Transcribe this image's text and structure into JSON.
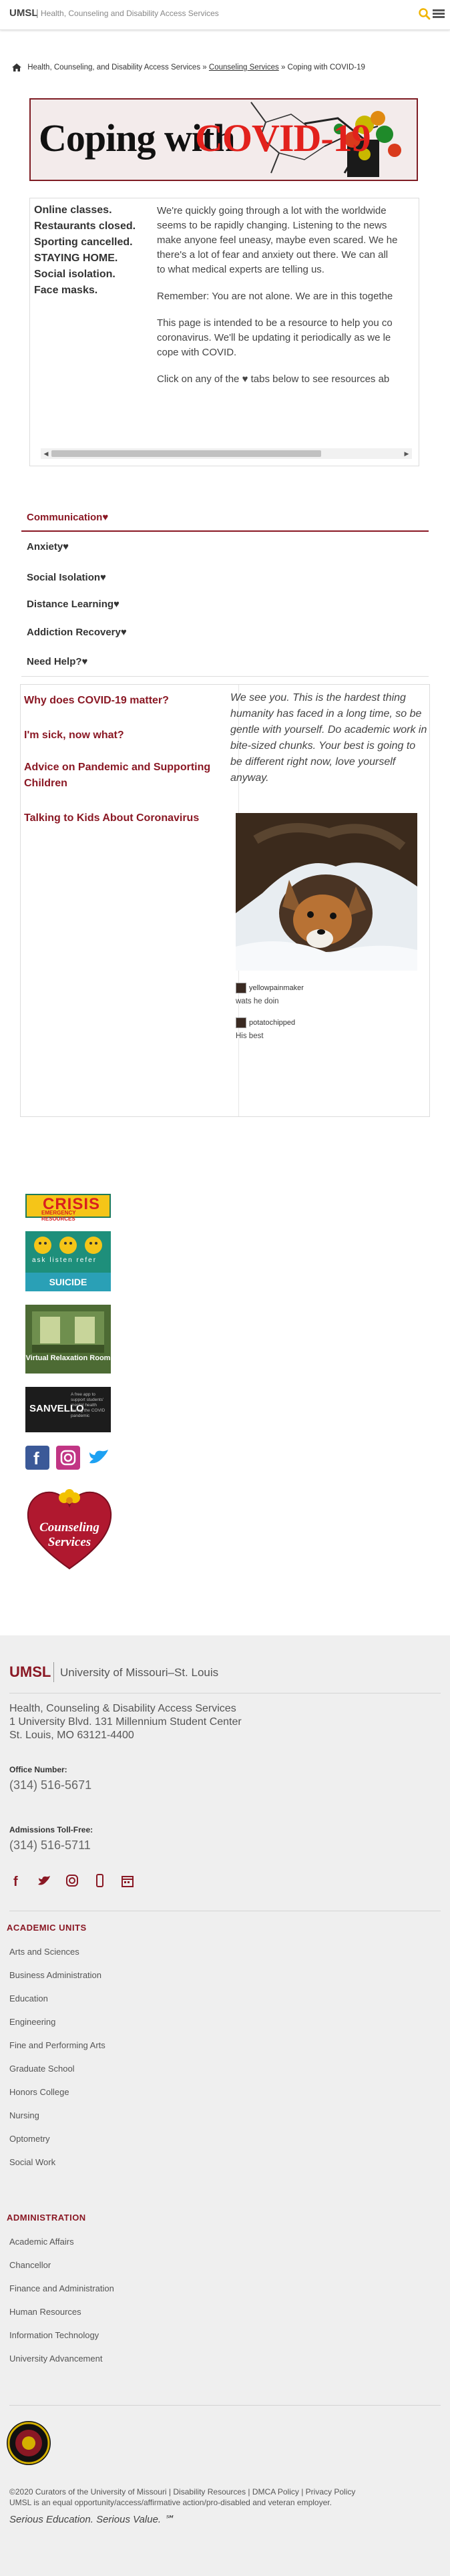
{
  "topbar": {
    "logo": "UMSL",
    "divider": "|",
    "site": "Health, Counseling and Disability Access Services",
    "search_icon": "search-icon",
    "menu_icon": "hamburger-menu-icon",
    "search_color": "#f0b400"
  },
  "breadcrumb": {
    "home_icon": "home-icon",
    "items": [
      "Health, Counseling, and Disability Access Services",
      "Counseling Services",
      "Coping with COVID-19"
    ],
    "separator": "»"
  },
  "banner": {
    "text1": "Coping with",
    "text2": "COVID-19"
  },
  "intro": {
    "left_items": [
      "Online classes.",
      "Restaurants closed.",
      "Sporting cancelled.",
      "STAYING HOME.",
      "Social isolation.",
      "Face masks."
    ],
    "paragraphs": [
      [
        "We're quickly going through a lot with the worldwide",
        "seems to be rapidly changing. Listening to the news",
        "make anyone feel uneasy, maybe even scared. We he",
        "there's a lot of fear and anxiety out there. We can all",
        "to what medical experts are telling us."
      ],
      [
        "Remember: You are not alone. We are in this togethe"
      ],
      [
        "This page is intended to be a resource to help you co",
        "coronavirus. We'll be updating it periodically as we le",
        "cope with COVID."
      ],
      [
        "Click on any of the ♥ tabs below to see resources ab"
      ]
    ]
  },
  "tabs": [
    "Communication♥",
    "Anxiety♥",
    "Social Isolation♥",
    "Distance Learning♥",
    "Addiction Recovery♥",
    "Need Help?♥"
  ],
  "panel": {
    "links": [
      "Why does COVID-19 matter?",
      "I'm sick, now what?",
      "Advice on Pandemic and Supporting Children",
      "Talking to Kids About Coronavirus"
    ],
    "quote": "We see you. This is the hardest thing humanity has faced in a long time, so be gentle with yourself. Do academic work in bite-sized chunks. Your best is going to be different right now, love yourself anyway.",
    "posts": [
      {
        "user": "yellowpainmaker",
        "caption": "wats he doin"
      },
      {
        "user": "potatochipped",
        "caption": "His best"
      }
    ]
  },
  "badges": {
    "crisis_title": "CRISIS",
    "crisis_sub": "EMERGENCY RESOURCES",
    "suicide_words": "ask   listen   refer",
    "suicide_title": "SUICIDE PREVENTION",
    "relax_title": "Virtual Relaxation Room",
    "sanvello_name": "SANVELLO",
    "sanvello_text": "A free app to support students' mental health during the COVID pandemic",
    "social_icons": [
      "facebook-icon",
      "instagram-icon",
      "twitter-icon"
    ],
    "heart_text": "Counseling Services"
  },
  "footer": {
    "logo": "UMSL",
    "university": "University of Missouri–St. Louis",
    "address": [
      "Health, Counseling & Disability Access Services",
      "1 University Blvd. 131 Millennium Student Center",
      "St. Louis, MO 63121-4400"
    ],
    "office_label": "Office Number:",
    "office_phone": "(314) 516-5671",
    "admissions_label": "Admissions Toll-Free:",
    "admissions_phone": "(314) 516-5711",
    "social_icons": [
      "facebook-icon",
      "twitter-icon",
      "instagram-icon",
      "mobile-icon",
      "calendar-icon"
    ],
    "academic_heading": "ACADEMIC UNITS",
    "academic_units": [
      "Arts and Sciences",
      "Business Administration",
      "Education",
      "Engineering",
      "Fine and Performing Arts",
      "Graduate School",
      "Honors College",
      "Nursing",
      "Optometry",
      "Social Work"
    ],
    "admin_heading": "ADMINISTRATION",
    "administration": [
      "Academic Affairs",
      "Chancellor",
      "Finance and Administration",
      "Human Resources",
      "Information Technology",
      "University Advancement"
    ],
    "copyright": "©2020 Curators of the University of Missouri  |  Disability Resources  |  DMCA Policy  |  Privacy Policy",
    "equal_opportunity": "UMSL is an equal opportunity/access/affirmative action/pro-disabled and veteran employer.",
    "tagline": "Serious Education. Serious Value. ℠"
  },
  "colors": {
    "brand": "#8a1824",
    "covid_red": "#e2211c"
  }
}
